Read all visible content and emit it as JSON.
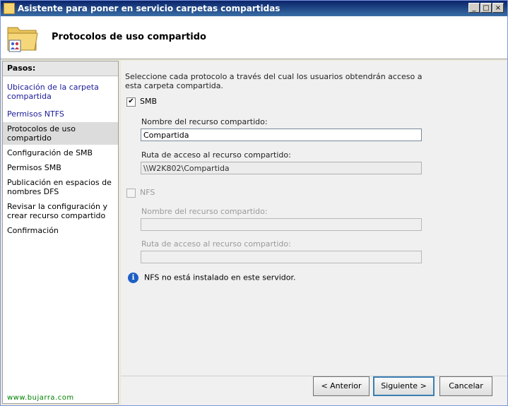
{
  "window": {
    "title": "Asistente para poner en servicio carpetas compartidas"
  },
  "titlebar_buttons": {
    "minimize": "_",
    "maximize": "□",
    "close": "×"
  },
  "header": {
    "title": "Protocolos de uso compartido"
  },
  "nav": {
    "heading": "Pasos:",
    "items": [
      {
        "label": "Ubicación de la carpeta compartida"
      },
      {
        "label": "Permisos NTFS"
      },
      {
        "label": "Protocolos de uso compartido"
      },
      {
        "label": "Configuración de SMB"
      },
      {
        "label": "Permisos SMB"
      },
      {
        "label": "Publicación en espacios de nombres DFS"
      },
      {
        "label": "Revisar la configuración y crear recurso compartido"
      },
      {
        "label": "Confirmación"
      }
    ],
    "watermark": "www.bujarra.com"
  },
  "main": {
    "intro": "Seleccione cada protocolo a través del cual los usuarios obtendrán acceso a esta carpeta compartida.",
    "smb": {
      "label": "SMB",
      "checked": true,
      "check_glyph": "✔",
      "share_name_label": "Nombre del recurso compartido:",
      "share_name_value": "Compartida",
      "share_path_label": "Ruta de acceso al recurso compartido:",
      "share_path_value": "\\\\W2K802\\Compartida"
    },
    "nfs": {
      "label": "NFS",
      "checked": false,
      "share_name_label": "Nombre del recurso compartido:",
      "share_name_value": "",
      "share_path_label": "Ruta de acceso al recurso compartido:",
      "share_path_value": ""
    },
    "info": {
      "icon": "info-icon",
      "text": "NFS no está instalado en este servidor."
    }
  },
  "footer": {
    "back_label": "< Anterior",
    "next_label": "Siguiente >",
    "cancel_label": "Cancelar"
  }
}
